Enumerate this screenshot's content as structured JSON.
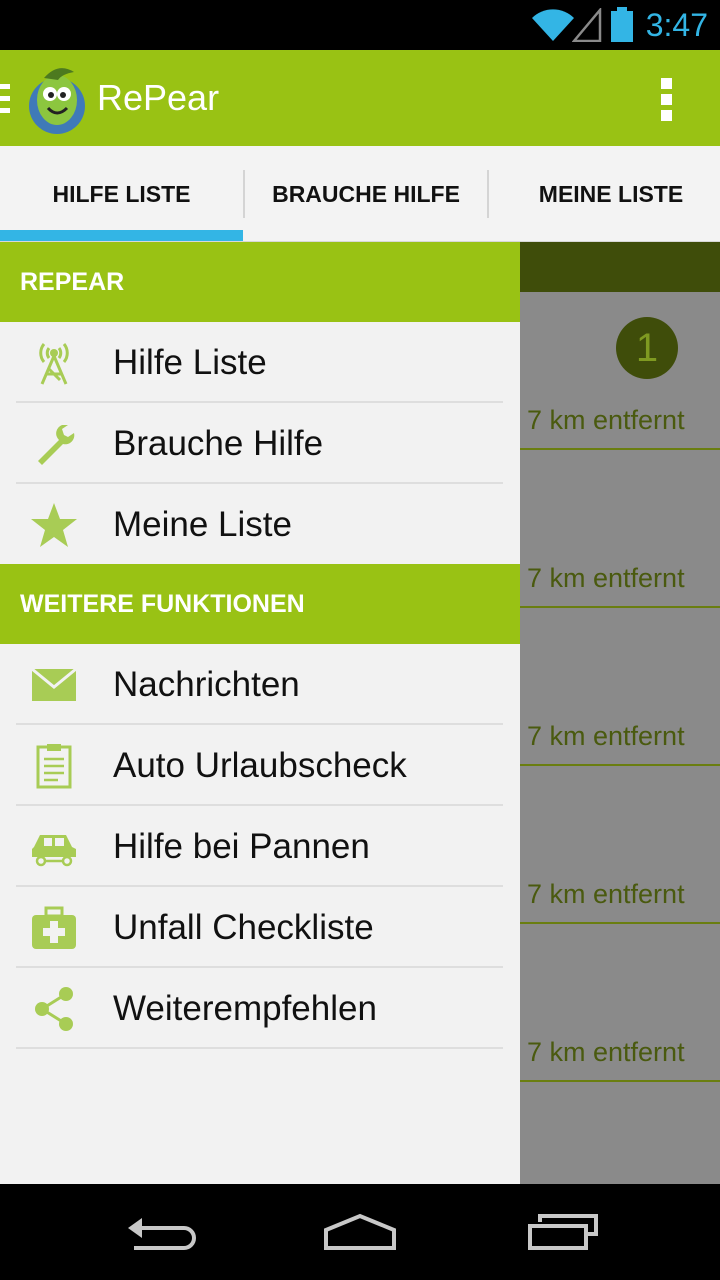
{
  "status_bar": {
    "time": "3:47",
    "icons": [
      "wifi-icon",
      "signal-icon",
      "battery-icon"
    ]
  },
  "action_bar": {
    "title": "RePear",
    "icons": [
      "drawer-indicator-icon",
      "app-logo",
      "overflow-menu-icon"
    ]
  },
  "tabs": [
    {
      "label": "HILFE LISTE",
      "selected": true
    },
    {
      "label": "BRAUCHE HILFE",
      "selected": false
    },
    {
      "label": "MEINE LISTE",
      "selected": false
    }
  ],
  "background_list": {
    "badge_count": "1",
    "rows": [
      {
        "distance": "7 km entfernt"
      },
      {
        "distance": "7 km entfernt"
      },
      {
        "distance": "7 km entfernt"
      },
      {
        "distance": "7 km entfernt"
      },
      {
        "distance": "7 km entfernt"
      }
    ]
  },
  "drawer": {
    "section_main": "REPEAR",
    "main_items": [
      {
        "label": "Hilfe Liste",
        "icon": "antenna-icon"
      },
      {
        "label": "Brauche Hilfe",
        "icon": "wrench-icon"
      },
      {
        "label": "Meine Liste",
        "icon": "star-icon"
      }
    ],
    "section_more": "WEITERE FUNKTIONEN",
    "more_items": [
      {
        "label": "Nachrichten",
        "icon": "envelope-icon"
      },
      {
        "label": "Auto Urlaubscheck",
        "icon": "clipboard-icon"
      },
      {
        "label": "Hilfe bei Pannen",
        "icon": "car-icon"
      },
      {
        "label": "Unfall Checkliste",
        "icon": "first-aid-kit-icon"
      },
      {
        "label": "Weiterempfehlen",
        "icon": "share-icon"
      }
    ]
  },
  "nav_bar": {
    "icons": [
      "back-icon",
      "home-icon",
      "recent-apps-icon"
    ]
  },
  "colors": {
    "accent_green": "#99c214",
    "icon_green": "#a8cc55",
    "tab_indicator": "#33b5e5"
  }
}
